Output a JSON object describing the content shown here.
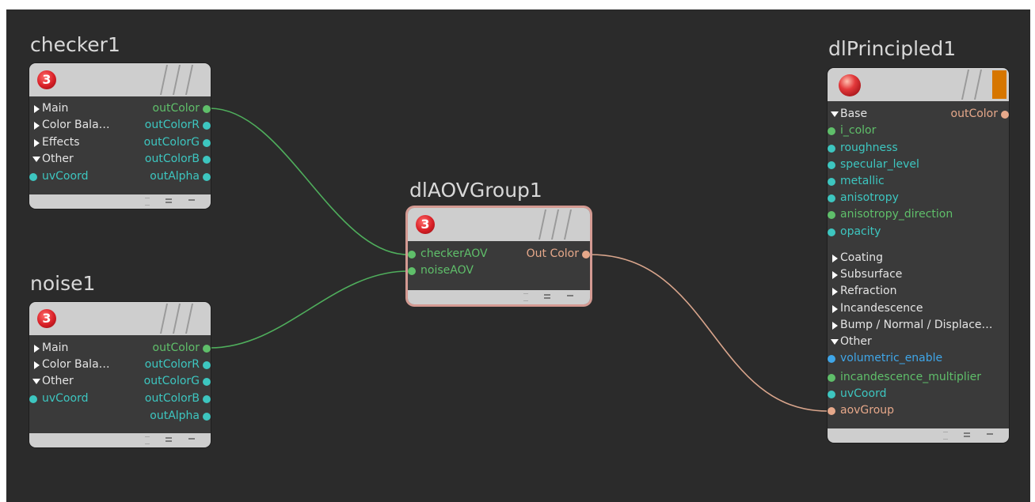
{
  "colors": {
    "background": "#2b2b2b",
    "node_body": "#3a3a3a",
    "node_header": "#cecece",
    "green": "#5fbf6a",
    "cyan": "#3dc6c0",
    "blue": "#3fa6e8",
    "salmon": "#e6a88a",
    "wire_green": "#4fae5c",
    "wire_salmon": "#d9a58c",
    "selected_outline": "#d49a92",
    "flag_orange": "#d67600"
  },
  "nodes": {
    "checker": {
      "title": "checker1",
      "icon": "hypershade-3-icon",
      "icon_text": "3",
      "inputs": [
        {
          "label": "Main",
          "kind": "collapsed"
        },
        {
          "label": "Color Bala…",
          "kind": "collapsed"
        },
        {
          "label": "Effects",
          "kind": "collapsed"
        },
        {
          "label": "Other",
          "kind": "expanded"
        },
        {
          "label": "uvCoord",
          "kind": "port",
          "color": "#3dc6c0"
        }
      ],
      "outputs": [
        {
          "label": "outColor",
          "color": "#5fbf6a"
        },
        {
          "label": "outColorR",
          "color": "#3dc6c0"
        },
        {
          "label": "outColorG",
          "color": "#3dc6c0"
        },
        {
          "label": "outColorB",
          "color": "#3dc6c0"
        },
        {
          "label": "outAlpha",
          "color": "#3dc6c0"
        }
      ]
    },
    "noise": {
      "title": "noise1",
      "icon": "hypershade-3-icon",
      "icon_text": "3",
      "inputs": [
        {
          "label": "Main",
          "kind": "collapsed"
        },
        {
          "label": "Color Bala…",
          "kind": "collapsed"
        },
        {
          "label": "Other",
          "kind": "expanded"
        },
        {
          "label": "uvCoord",
          "kind": "port",
          "color": "#3dc6c0"
        }
      ],
      "outputs": [
        {
          "label": "outColor",
          "color": "#5fbf6a"
        },
        {
          "label": "outColorR",
          "color": "#3dc6c0"
        },
        {
          "label": "outColorG",
          "color": "#3dc6c0"
        },
        {
          "label": "outColorB",
          "color": "#3dc6c0"
        },
        {
          "label": "outAlpha",
          "color": "#3dc6c0"
        }
      ]
    },
    "aov": {
      "title": "dlAOVGroup1",
      "icon": "hypershade-3-icon",
      "icon_text": "3",
      "inputs": [
        {
          "label": "checkerAOV",
          "kind": "port",
          "color": "#5fbf6a"
        },
        {
          "label": "noiseAOV",
          "kind": "port",
          "color": "#5fbf6a"
        }
      ],
      "outputs": [
        {
          "label": "Out Color",
          "color": "#e6a88a"
        }
      ]
    },
    "principled": {
      "title": "dlPrincipled1",
      "icon": "material-sphere-icon",
      "output": {
        "label": "outColor",
        "color": "#e6a88a"
      },
      "rows": [
        {
          "label": "Base",
          "kind": "expanded"
        },
        {
          "label": "i_color",
          "kind": "port",
          "color": "#5fbf6a"
        },
        {
          "label": "roughness",
          "kind": "port",
          "color": "#3dc6c0"
        },
        {
          "label": "specular_level",
          "kind": "port",
          "color": "#3dc6c0"
        },
        {
          "label": "metallic",
          "kind": "port",
          "color": "#3dc6c0"
        },
        {
          "label": "anisotropy",
          "kind": "port",
          "color": "#3dc6c0"
        },
        {
          "label": "anisotropy_direction",
          "kind": "port",
          "color": "#5fbf6a"
        },
        {
          "label": "opacity",
          "kind": "port",
          "color": "#3dc6c0"
        },
        {
          "label": "Coating",
          "kind": "collapsed"
        },
        {
          "label": "Subsurface",
          "kind": "collapsed"
        },
        {
          "label": "Refraction",
          "kind": "collapsed"
        },
        {
          "label": "Incandescence",
          "kind": "collapsed"
        },
        {
          "label": "Bump / Normal / Displace…",
          "kind": "collapsed"
        },
        {
          "label": "Other",
          "kind": "expanded"
        },
        {
          "label": "volumetric_enable",
          "kind": "port",
          "color": "#3fa6e8"
        },
        {
          "label": "incandescence_multiplier",
          "kind": "port",
          "color": "#5fbf6a"
        },
        {
          "label": "uvCoord",
          "kind": "port",
          "color": "#3dc6c0"
        },
        {
          "label": "aovGroup",
          "kind": "port",
          "color": "#e6a88a"
        }
      ]
    }
  }
}
